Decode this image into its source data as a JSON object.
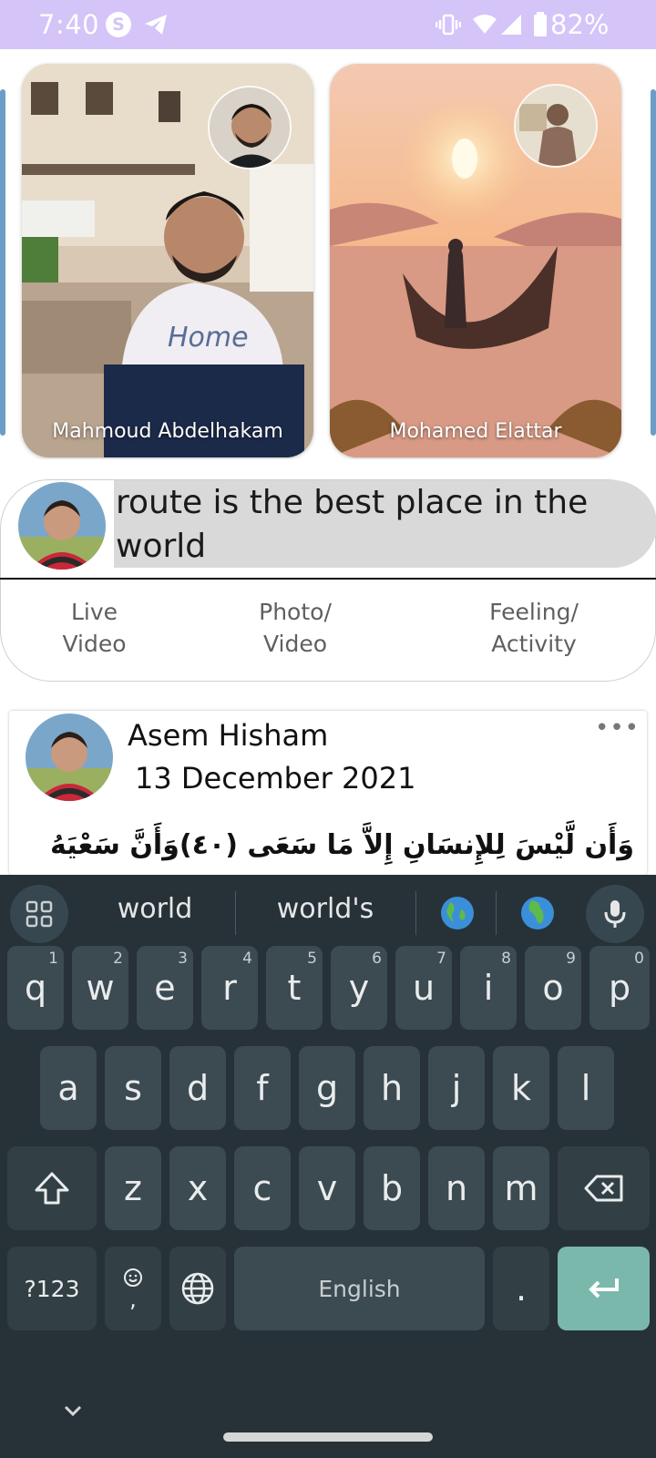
{
  "status_bar": {
    "time": "7:40",
    "battery": "82%",
    "background_color": "#d4c4f8"
  },
  "stories": [
    {
      "name": "Mahmoud Abdelhakam"
    },
    {
      "name": "Mohamed Elattar"
    }
  ],
  "composer": {
    "input_text": "route is the best place in the world",
    "actions": {
      "live_video": "Live\nVideo",
      "photo_video": "Photo/\nVideo",
      "feeling_activity": "Feeling/\nActivity"
    }
  },
  "post": {
    "author": "Asem Hisham",
    "date": "13 December 2021",
    "more": "•••",
    "text": "وَأَن لَّيْسَ لِلإِنسَانِ إِلاَّ مَا سَعَى (٤٠)وَأَنَّ سَعْيَهُ"
  },
  "keyboard": {
    "suggestions": [
      "world",
      "world's"
    ],
    "emoji_suggestions": [
      "globe-americas-icon",
      "globe-europe-africa-icon"
    ],
    "row1": [
      {
        "key": "q",
        "hint": "1"
      },
      {
        "key": "w",
        "hint": "2"
      },
      {
        "key": "e",
        "hint": "3"
      },
      {
        "key": "r",
        "hint": "4"
      },
      {
        "key": "t",
        "hint": "5"
      },
      {
        "key": "y",
        "hint": "6"
      },
      {
        "key": "u",
        "hint": "7"
      },
      {
        "key": "i",
        "hint": "8"
      },
      {
        "key": "o",
        "hint": "9"
      },
      {
        "key": "p",
        "hint": "0"
      }
    ],
    "row2": [
      "a",
      "s",
      "d",
      "f",
      "g",
      "h",
      "j",
      "k",
      "l"
    ],
    "row3": [
      "z",
      "x",
      "c",
      "v",
      "b",
      "n",
      "m"
    ],
    "symbols_key": "?123",
    "comma_key": ",",
    "space_label": "English",
    "period_key": ".",
    "accent_color": "#7ab8ac"
  }
}
